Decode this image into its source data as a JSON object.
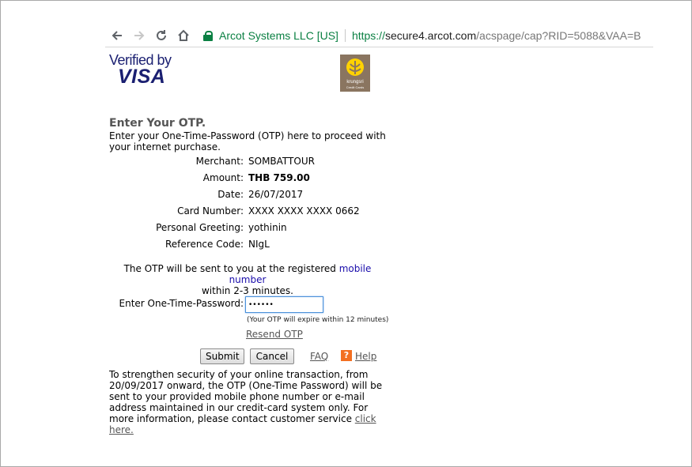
{
  "browser": {
    "cert_label": "Arcot Systems LLC [US]",
    "url_scheme": "https://",
    "url_host": "secure4.arcot.com",
    "url_path": "/acspage/cap?RID=5088&VAA=B",
    "icons": {
      "back": "back-arrow-icon",
      "forward": "forward-arrow-icon",
      "reload": "reload-icon",
      "home": "home-icon",
      "lock": "lock-icon"
    }
  },
  "logos": {
    "visa_top": "Verified by",
    "visa_word": "VISA",
    "bank_name": "krungsri",
    "bank_sub": "Credit Cards",
    "bank_color": "#8a7560",
    "bank_emblem_color": "#ffd200"
  },
  "page": {
    "heading": "Enter Your OTP.",
    "intro": "Enter your One-Time-Password (OTP) here to proceed with your internet purchase.",
    "details": [
      {
        "label": "Merchant:",
        "value": "SOMBATTOUR",
        "bold": false
      },
      {
        "label": "Amount:",
        "value": "THB 759.00",
        "bold": true
      },
      {
        "label": "Date:",
        "value": "26/07/2017",
        "bold": false
      },
      {
        "label": "Card Number:",
        "value": "XXXX XXXX XXXX 0662",
        "bold": false
      },
      {
        "label": "Personal Greeting:",
        "value": "yothinin",
        "bold": false
      },
      {
        "label": "Reference Code:",
        "value": "NIgL",
        "bold": false
      }
    ],
    "otp_note_pre": "The OTP will be sent to you at the registered ",
    "otp_note_link": "mobile number",
    "otp_note_post": "within 2-3 minutes.",
    "otp_label": "Enter One-Time-Password:",
    "otp_value": "••••••",
    "expire_note": "(Your OTP will expire within 12 minutes)",
    "resend": "Resend OTP",
    "submit": "Submit",
    "cancel": "Cancel",
    "faq": "FAQ",
    "help_icon_glyph": "?",
    "help": "Help",
    "help_color": "#f36f21",
    "security_text": "To strengthen security of your online transaction, from 20/09/2017 onward, the OTP (One-Time Password) will be sent to your provided mobile phone number or e-mail address maintained in our credit-card system only. For more information, please contact customer service ",
    "security_link": "click here."
  }
}
